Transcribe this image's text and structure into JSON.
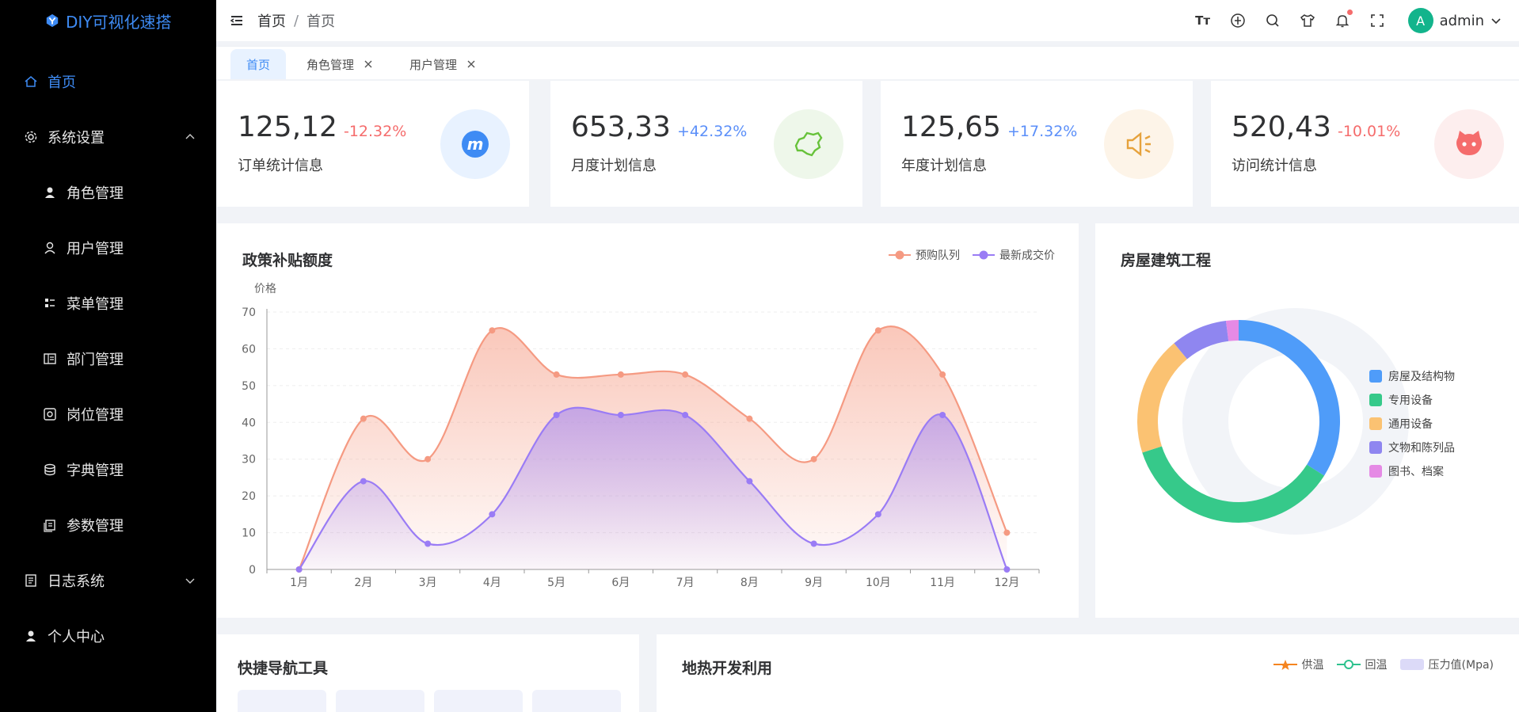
{
  "app": {
    "logo_text": "DIY可视化速搭"
  },
  "sidebar": {
    "items": [
      {
        "label": "首页",
        "icon": "home-icon",
        "level": "top",
        "active": true
      },
      {
        "label": "系统设置",
        "icon": "gear-icon",
        "level": "top",
        "expanded": true
      },
      {
        "label": "角色管理",
        "icon": "user-solid-icon",
        "level": "sub"
      },
      {
        "label": "用户管理",
        "icon": "user-icon",
        "level": "sub"
      },
      {
        "label": "菜单管理",
        "icon": "menu-icon",
        "level": "sub"
      },
      {
        "label": "部门管理",
        "icon": "department-icon",
        "level": "sub"
      },
      {
        "label": "岗位管理",
        "icon": "post-icon",
        "level": "sub"
      },
      {
        "label": "字典管理",
        "icon": "dictionary-icon",
        "level": "sub"
      },
      {
        "label": "参数管理",
        "icon": "params-icon",
        "level": "sub"
      },
      {
        "label": "日志系统",
        "icon": "log-icon",
        "level": "top",
        "expanded": false
      },
      {
        "label": "个人中心",
        "icon": "profile-icon",
        "level": "top"
      }
    ]
  },
  "header": {
    "breadcrumb": [
      "首页",
      "首页"
    ],
    "separator": "/",
    "font_tool_text": "Tт",
    "user": {
      "avatar_letter": "A",
      "name": "admin"
    }
  },
  "tabs": [
    {
      "label": "首页",
      "active": true,
      "closable": false
    },
    {
      "label": "角色管理",
      "active": false,
      "closable": true
    },
    {
      "label": "用户管理",
      "active": false,
      "closable": true
    }
  ],
  "stats": [
    {
      "value": "125,12",
      "delta": "-12.32%",
      "delta_color": "#f56c6c",
      "label": "订单统计信息",
      "icon": "meituan-icon",
      "circle_color": "#e8f2ff",
      "icon_color": "#3e8bf4"
    },
    {
      "value": "653,33",
      "delta": "+42.32%",
      "delta_color": "#5b8ff9",
      "label": "月度计划信息",
      "icon": "china-map-icon",
      "circle_color": "#eef7ea",
      "icon_color": "#67c23a"
    },
    {
      "value": "125,65",
      "delta": "+17.32%",
      "delta_color": "#5b8ff9",
      "label": "年度计划信息",
      "icon": "speaker-icon",
      "circle_color": "#fdf4e8",
      "icon_color": "#e6a23c"
    },
    {
      "value": "520,43",
      "delta": "-10.01%",
      "delta_color": "#f56c6c",
      "label": "访问统计信息",
      "icon": "github-cat-icon",
      "circle_color": "#fdeeee",
      "icon_color": "#f56c6c"
    }
  ],
  "panels": {
    "subsidy": {
      "title": "政策补贴额度"
    },
    "building": {
      "title": "房屋建筑工程"
    },
    "quick_nav": {
      "title": "快捷导航工具"
    },
    "geothermal": {
      "title": "地热开发利用",
      "legend": [
        {
          "name": "供温",
          "color": "#f5841f"
        },
        {
          "name": "回温",
          "color": "#2ec28e"
        },
        {
          "name": "压力值(Mpa)",
          "color": "#d9d9f7"
        }
      ]
    }
  },
  "chart_data": [
    {
      "type": "area",
      "title": "政策补贴额度",
      "xlabel": "",
      "ylabel": "价格",
      "categories": [
        "1月",
        "2月",
        "3月",
        "4月",
        "5月",
        "6月",
        "7月",
        "8月",
        "9月",
        "10月",
        "11月",
        "12月"
      ],
      "ylim": [
        0,
        70
      ],
      "yticks": [
        0,
        10,
        20,
        30,
        40,
        50,
        60,
        70
      ],
      "grid": true,
      "legend_position": "top-right",
      "series": [
        {
          "name": "预购队列",
          "color": "#f59a82",
          "values": [
            0,
            41,
            30,
            65,
            53,
            53,
            53,
            41,
            30,
            65,
            53,
            10
          ]
        },
        {
          "name": "最新成交价",
          "color": "#9a7cf5",
          "values": [
            0,
            24,
            7,
            15,
            42,
            42,
            42,
            24,
            7,
            15,
            42,
            0
          ]
        }
      ]
    },
    {
      "type": "pie",
      "title": "房屋建筑工程",
      "legend_position": "right",
      "series": [
        {
          "name": "房屋及结构物",
          "color": "#4f9cf9",
          "value": 34
        },
        {
          "name": "专用设备",
          "color": "#36c98a",
          "value": 36
        },
        {
          "name": "通用设备",
          "color": "#fbc272",
          "value": 19
        },
        {
          "name": "文物和陈列品",
          "color": "#8f86f0",
          "value": 9
        },
        {
          "name": "图书、档案",
          "color": "#e58ae5",
          "value": 2
        }
      ]
    }
  ]
}
